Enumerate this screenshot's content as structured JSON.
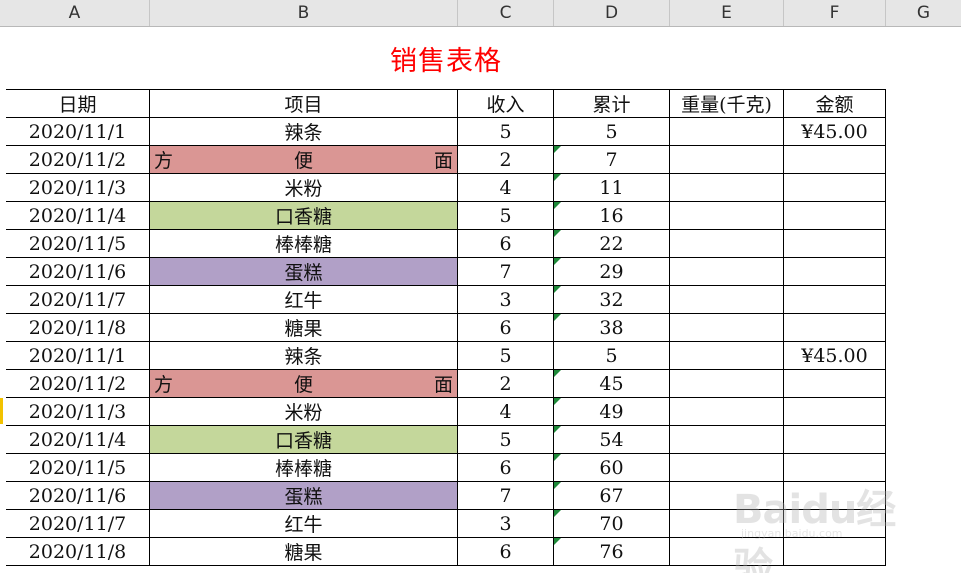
{
  "columns": [
    "A",
    "B",
    "C",
    "D",
    "E",
    "F",
    "G"
  ],
  "title": "销售表格",
  "headers": [
    "日期",
    "项目",
    "收入",
    "累计",
    "重量(千克)",
    "金额"
  ],
  "rows": [
    {
      "date": "2020/11/1",
      "item": "辣条",
      "income": "5",
      "total": "5",
      "weight": "",
      "amount": "¥45.00",
      "fill": "",
      "marked": false
    },
    {
      "date": "2020/11/2",
      "item": "方便面",
      "income": "2",
      "total": "7",
      "weight": "",
      "amount": "",
      "fill": "pink",
      "marked": true
    },
    {
      "date": "2020/11/3",
      "item": "米粉",
      "income": "4",
      "total": "11",
      "weight": "",
      "amount": "",
      "fill": "",
      "marked": true
    },
    {
      "date": "2020/11/4",
      "item": "口香糖",
      "income": "5",
      "total": "16",
      "weight": "",
      "amount": "",
      "fill": "green",
      "marked": true
    },
    {
      "date": "2020/11/5",
      "item": "棒棒糖",
      "income": "6",
      "total": "22",
      "weight": "",
      "amount": "",
      "fill": "",
      "marked": true
    },
    {
      "date": "2020/11/6",
      "item": "蛋糕",
      "income": "7",
      "total": "29",
      "weight": "",
      "amount": "",
      "fill": "purple",
      "marked": true
    },
    {
      "date": "2020/11/7",
      "item": "红牛",
      "income": "3",
      "total": "32",
      "weight": "",
      "amount": "",
      "fill": "",
      "marked": true
    },
    {
      "date": "2020/11/8",
      "item": "糖果",
      "income": "6",
      "total": "38",
      "weight": "",
      "amount": "",
      "fill": "",
      "marked": true
    },
    {
      "date": "2020/11/1",
      "item": "辣条",
      "income": "5",
      "total": "5",
      "weight": "",
      "amount": "¥45.00",
      "fill": "",
      "marked": false
    },
    {
      "date": "2020/11/2",
      "item": "方便面",
      "income": "2",
      "total": "45",
      "weight": "",
      "amount": "",
      "fill": "pink",
      "marked": true
    },
    {
      "date": "2020/11/3",
      "item": "米粉",
      "income": "4",
      "total": "49",
      "weight": "",
      "amount": "",
      "fill": "",
      "marked": true
    },
    {
      "date": "2020/11/4",
      "item": "口香糖",
      "income": "5",
      "total": "54",
      "weight": "",
      "amount": "",
      "fill": "green",
      "marked": true
    },
    {
      "date": "2020/11/5",
      "item": "棒棒糖",
      "income": "6",
      "total": "60",
      "weight": "",
      "amount": "",
      "fill": "",
      "marked": true
    },
    {
      "date": "2020/11/6",
      "item": "蛋糕",
      "income": "7",
      "total": "67",
      "weight": "",
      "amount": "",
      "fill": "purple",
      "marked": true
    },
    {
      "date": "2020/11/7",
      "item": "红牛",
      "income": "3",
      "total": "70",
      "weight": "",
      "amount": "",
      "fill": "",
      "marked": true
    },
    {
      "date": "2020/11/8",
      "item": "糖果",
      "income": "6",
      "total": "76",
      "weight": "",
      "amount": "",
      "fill": "",
      "marked": true
    }
  ],
  "watermark": {
    "text": "Baidu经验",
    "sub": "jingyan.baidu.com"
  },
  "colors": {
    "title": "#ff0000",
    "fill_pink": "#da9694",
    "fill_green": "#c4d79b",
    "fill_purple": "#b1a0c7",
    "error_marker": "#1f8a3a"
  }
}
